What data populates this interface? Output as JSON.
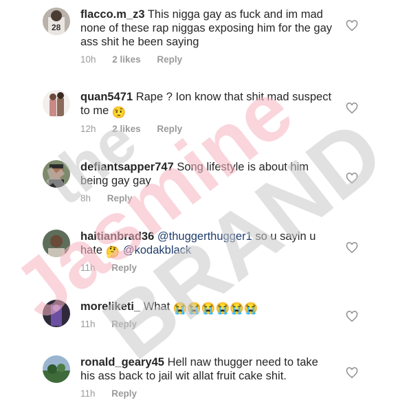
{
  "comments": [
    {
      "username": "flacco.m_z3",
      "text": "This nigga gay as fuck and im mad none of these rap niggas exposing him for the gay ass shit he been saying",
      "time": "10h",
      "likes": "2 likes",
      "reply": "Reply"
    },
    {
      "username": "quan5471",
      "text": "Rape ? Ion know that shit mad suspect to me",
      "emoji": "🤨",
      "time": "12h",
      "likes": "2 likes",
      "reply": "Reply"
    },
    {
      "username": "defiantsapper747",
      "text": "Song lifestyle is about him being gay gay",
      "time": "8h",
      "reply": "Reply"
    },
    {
      "username": "haitianbrad36",
      "mention1": "@thuggerthugger1",
      "text_mid": "so u sayin u hate",
      "emoji": "🤔",
      "mention2": "@kodakblack",
      "time": "11h",
      "reply": "Reply"
    },
    {
      "username": "moreliketi_",
      "text": "What",
      "emojis": "😭😭😭😭😭😭",
      "time": "11h",
      "reply": "Reply"
    },
    {
      "username": "ronald_geary45",
      "text": "Hell naw thugger need to take his ass back to jail wit allat fruit cake shit.",
      "time": "11h",
      "reply": "Reply"
    }
  ],
  "watermark": {
    "line1": "the",
    "line2": "Jasmine",
    "line3": "BRAND",
    "pink": "#f6b3c1",
    "gray": "#c9c9c9"
  },
  "colors": {
    "meta": "#9a9a9a",
    "mention": "#1f3d6b",
    "heart_stroke": "#8e8e8e"
  }
}
